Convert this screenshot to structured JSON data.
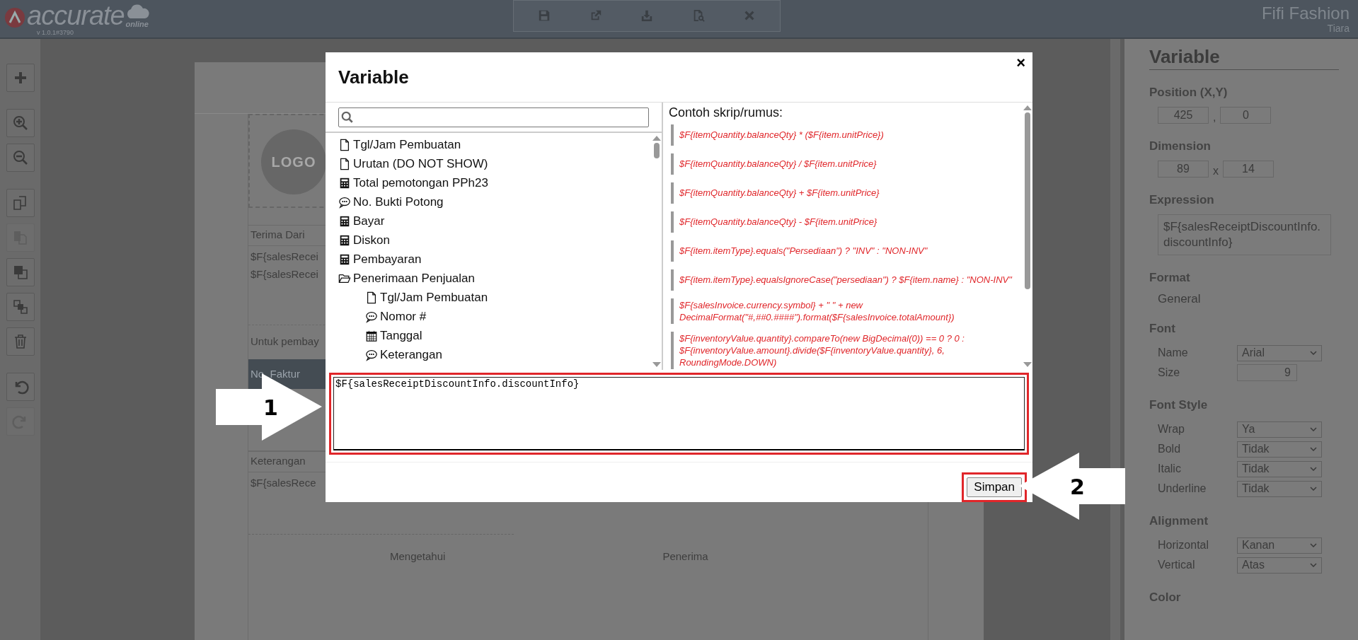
{
  "app": {
    "logo": "accurate",
    "logo_sub": "online",
    "version": "v 1.0.1#3790",
    "company": "Fifi Fashion",
    "user": "Tiara"
  },
  "top_toolbar": [
    {
      "kind": "save"
    },
    {
      "kind": "export"
    },
    {
      "kind": "download"
    },
    {
      "kind": "preview"
    },
    {
      "kind": "close"
    }
  ],
  "left_toolbar": [
    {
      "kind": "add",
      "disabled": false
    },
    {
      "kind": "zoom_in",
      "disabled": false
    },
    {
      "kind": "zoom_out",
      "disabled": false
    },
    {
      "kind": "copy",
      "disabled": false
    },
    {
      "kind": "paste",
      "disabled": true
    },
    {
      "kind": "front",
      "disabled": false
    },
    {
      "kind": "back",
      "disabled": false
    },
    {
      "kind": "delete",
      "disabled": false
    },
    {
      "kind": "undo",
      "disabled": false
    },
    {
      "kind": "redo",
      "disabled": true
    }
  ],
  "document": {
    "logo": "LOGO",
    "received_from": "Terima Dari",
    "fields": [
      "$F{salesRecei",
      "$F{salesRecei"
    ],
    "payment_for": "Untuk pembay",
    "table_header": "No. Faktur",
    "notes_label": "Keterangan",
    "notes_value": "$F{salesRece",
    "signatures": [
      "Mengetahui",
      "Penerima"
    ]
  },
  "dialog": {
    "title": "Variable",
    "close": "×",
    "tree": [
      {
        "label": "Tgl/Jam Pembuatan",
        "kind": "file"
      },
      {
        "label": "Urutan (DO NOT SHOW)",
        "kind": "file"
      },
      {
        "label": "Total pemotongan PPh23",
        "kind": "number"
      },
      {
        "label": "No. Bukti Potong",
        "kind": "text"
      },
      {
        "label": "Bayar",
        "kind": "number"
      },
      {
        "label": "Diskon",
        "kind": "number"
      },
      {
        "label": "Pembayaran",
        "kind": "number"
      },
      {
        "label": "Penerimaan Penjualan",
        "kind": "folder",
        "expanded": true,
        "children": [
          {
            "label": "Tgl/Jam Pembuatan",
            "kind": "file"
          },
          {
            "label": "Nomor #",
            "kind": "text"
          },
          {
            "label": "Tanggal",
            "kind": "date"
          },
          {
            "label": "Keterangan",
            "kind": "text"
          }
        ]
      }
    ],
    "examples_title": "Contoh skrip/rumus:",
    "examples": [
      "$F{itemQuantity.balanceQty} * ($F{item.unitPrice})",
      "$F{itemQuantity.balanceQty} / $F{item.unitPrice}",
      "$F{itemQuantity.balanceQty} + $F{item.unitPrice}",
      "$F{itemQuantity.balanceQty} - $F{item.unitPrice}",
      "$F{item.itemType}.equals(\"Persediaan\") ? \"INV\" : \"NON-INV\"",
      "$F{item.itemType}.equalsIgnoreCase(\"persediaan\") ? $F{item.name} : \"NON-INV\"",
      "$F{salesInvoice.currency.symbol} + \" \" + new DecimalFormat(\"#,##0.####\").format($F{salesInvoice.totalAmount})",
      "$F{inventoryValue.quantity}.compareTo(new BigDecimal(0)) == 0 ? 0 : $F{inventoryValue.amount}.divide($F{inventoryValue.quantity}, 6, RoundingMode.DOWN)"
    ],
    "expression": "$F{salesReceiptDiscountInfo.discountInfo}",
    "save_button": "Simpan"
  },
  "callouts": [
    {
      "label": "1",
      "kind": "right"
    },
    {
      "label": "2",
      "kind": "left"
    }
  ],
  "properties": {
    "title": "Variable",
    "sections": [
      {
        "heading": "Position (X,Y)",
        "kind": "pair",
        "values": [
          "425",
          "0"
        ],
        "separator": ","
      },
      {
        "heading": "Dimension",
        "kind": "pair",
        "values": [
          "89",
          "14"
        ],
        "separator": "x"
      },
      {
        "heading": "Expression",
        "kind": "text_box",
        "value": "$F{salesReceiptDiscountInfo.discountInfo}"
      },
      {
        "heading": "Format",
        "kind": "plain",
        "value": "General"
      },
      {
        "heading": "Font",
        "kind": "rows",
        "rows": [
          {
            "label": "Name",
            "kind": "select",
            "value": "Arial"
          },
          {
            "label": "Size",
            "kind": "input",
            "value": "9"
          }
        ]
      },
      {
        "heading": "Font Style",
        "kind": "rows",
        "rows": [
          {
            "label": "Wrap",
            "kind": "select",
            "value": "Ya"
          },
          {
            "label": "Bold",
            "kind": "select",
            "value": "Tidak"
          },
          {
            "label": "Italic",
            "kind": "select",
            "value": "Tidak"
          },
          {
            "label": "Underline",
            "kind": "select",
            "value": "Tidak"
          }
        ]
      },
      {
        "heading": "Alignment",
        "kind": "rows",
        "rows": [
          {
            "label": "Horizontal",
            "kind": "select",
            "value": "Kanan"
          },
          {
            "label": "Vertical",
            "kind": "select",
            "value": "Atas"
          }
        ]
      },
      {
        "heading": "Color",
        "kind": "heading"
      }
    ]
  }
}
